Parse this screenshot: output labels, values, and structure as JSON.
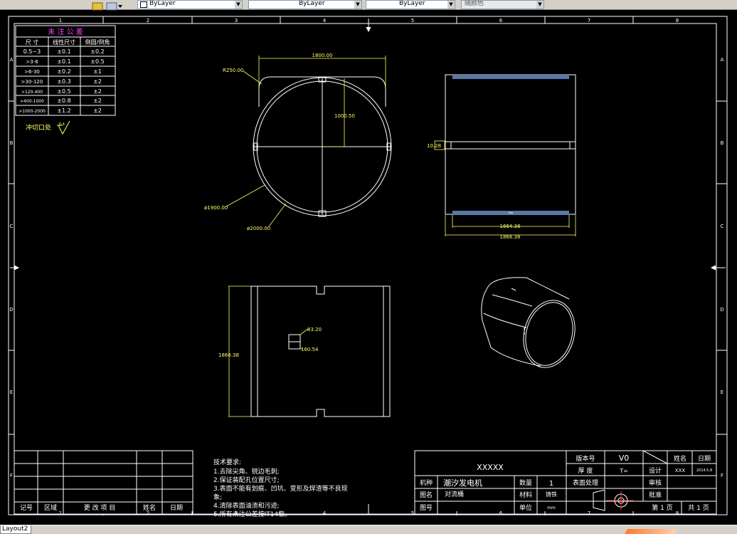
{
  "toolbar": {
    "linetype_value": "ByLayer",
    "lineweight_value": "ByLayer",
    "linecolor_value": "ByLayer",
    "plotstyle_value": "随颜色"
  },
  "layout_tab": "Layout2",
  "frame": {
    "col_numbers": [
      "1",
      "2",
      "3",
      "4",
      "5",
      "6",
      "7",
      "8"
    ],
    "row_letters": [
      "A",
      "B",
      "C",
      "D",
      "E",
      "F"
    ]
  },
  "tolerance_table": {
    "title": "未 注 公 差",
    "headers": [
      "尺 寸",
      "线性尺寸",
      "倒圆/倒角"
    ],
    "rows": [
      [
        "0.5~3",
        "±0.1",
        "±0.2"
      ],
      [
        ">3-6",
        "±0.1",
        "±0.5"
      ],
      [
        ">6-30",
        "±0.2",
        "±1"
      ],
      [
        ">30-120",
        "±0.3",
        "±2"
      ],
      [
        ">120-400",
        "±0.5",
        "±2"
      ],
      [
        ">400-1000",
        "±0.8",
        "±2"
      ],
      [
        ">1000-2000",
        "±1.2",
        "±2"
      ]
    ],
    "cut_note": "冲切口处",
    "roughness": "6.4"
  },
  "dims": {
    "top_width": "1800.00",
    "radius": "R250.00",
    "half_height": "1000.50",
    "inner_dia": "ø1900.00",
    "outer_dia": "ø2000.00",
    "side_notch": "10.28",
    "inner_len": "1664.38",
    "outer_len": "1866.38",
    "flat_height": "1866.38",
    "hole_w": "83.20",
    "hole_h": "160.54"
  },
  "tech": {
    "title": "技术要求:",
    "lines": [
      "1.去除尖角、锐边毛刺;",
      "2.保证装配孔位置尺寸;",
      "3.表面不能有划痕、凹坑、变形及焊渣等不良现",
      "象;",
      "4.清除表面油渍和污迹;",
      "5.所有未注公差按IT14级。"
    ]
  },
  "revision_block": {
    "headers": [
      "记号",
      "区域",
      "更 改 项 目",
      "姓名",
      "日期"
    ]
  },
  "title_block": {
    "drawing_title": "XXXXX",
    "version_label": "版本号",
    "version_value": "V0",
    "thickness_label": "厚 度",
    "thickness_value": "T=",
    "name_label": "姓名",
    "date_label": "日期",
    "design_label": "设计",
    "design_name": "XXX",
    "design_date": "2014.5.8",
    "machine_label": "机种",
    "machine_value": "潮汐发电机",
    "qty_label": "数量",
    "qty_value": "1",
    "surface_label": "表面处理",
    "review_label": "审核",
    "partname_label": "图名",
    "partname_value": "对流桶",
    "material_label": "材料",
    "material_value": "铸铁",
    "approve_label": "批准",
    "drawno_label": "图号",
    "unit_label": "单位",
    "unit_value": "mm",
    "page_text": "第 1 页",
    "total_text": "共 1 页"
  },
  "colors": {
    "background": "#000000",
    "frame": "#ffffff",
    "geometry": "#ffffff",
    "dimension": "#ffff66",
    "table_title": "#ff44ff",
    "table_text": "#ffffff",
    "highlight_band": "#5878a8"
  }
}
